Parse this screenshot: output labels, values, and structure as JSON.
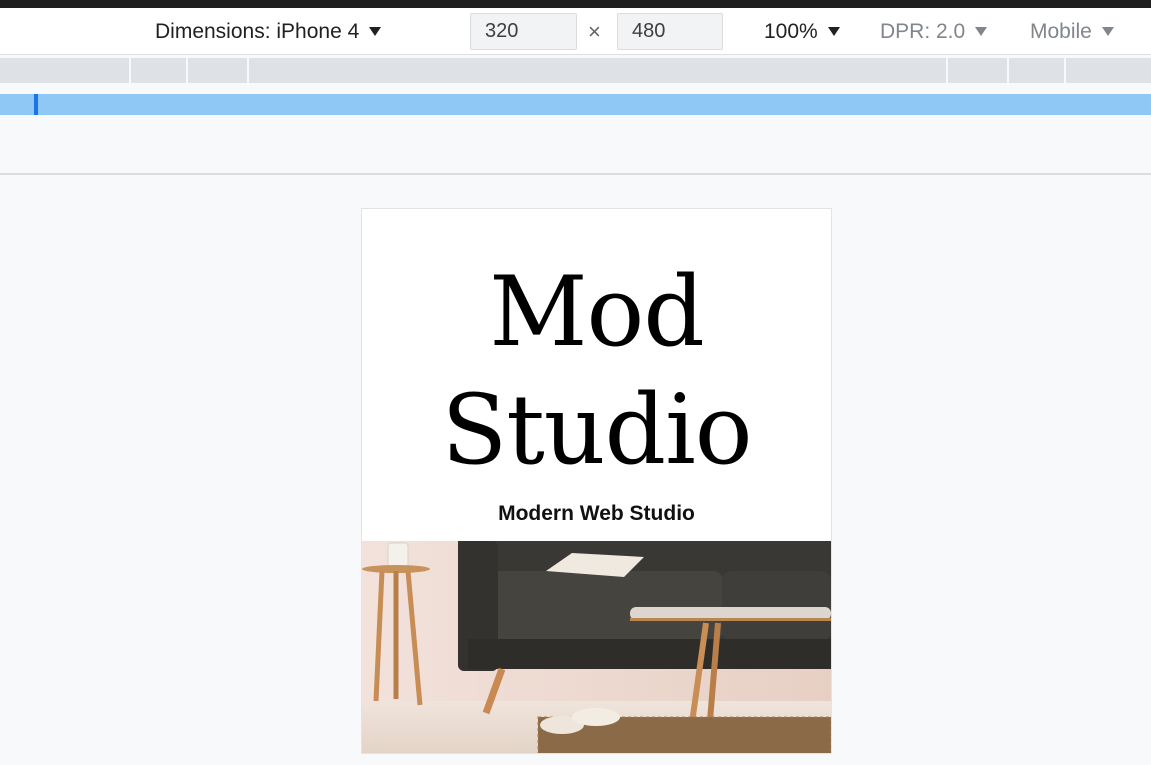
{
  "toolbar": {
    "dimensions_label": "Dimensions: iPhone 4",
    "width_value": "320",
    "times_symbol": "×",
    "height_value": "480",
    "zoom_label": "100%",
    "dpr_label": "DPR: 2.0",
    "mode_label": "Mobile"
  },
  "page": {
    "brand_line1": "Mod",
    "brand_line2": "Studio",
    "subtitle": "Modern Web Studio",
    "hero_image": "living-room-sofa-photo"
  },
  "colors": {
    "breakpoint_bar": "#8fc8f5",
    "breakpoint_marker": "#1a73e8",
    "viewport_bg": "#f8f9fa",
    "outer_frame": "#1f1f1f"
  }
}
